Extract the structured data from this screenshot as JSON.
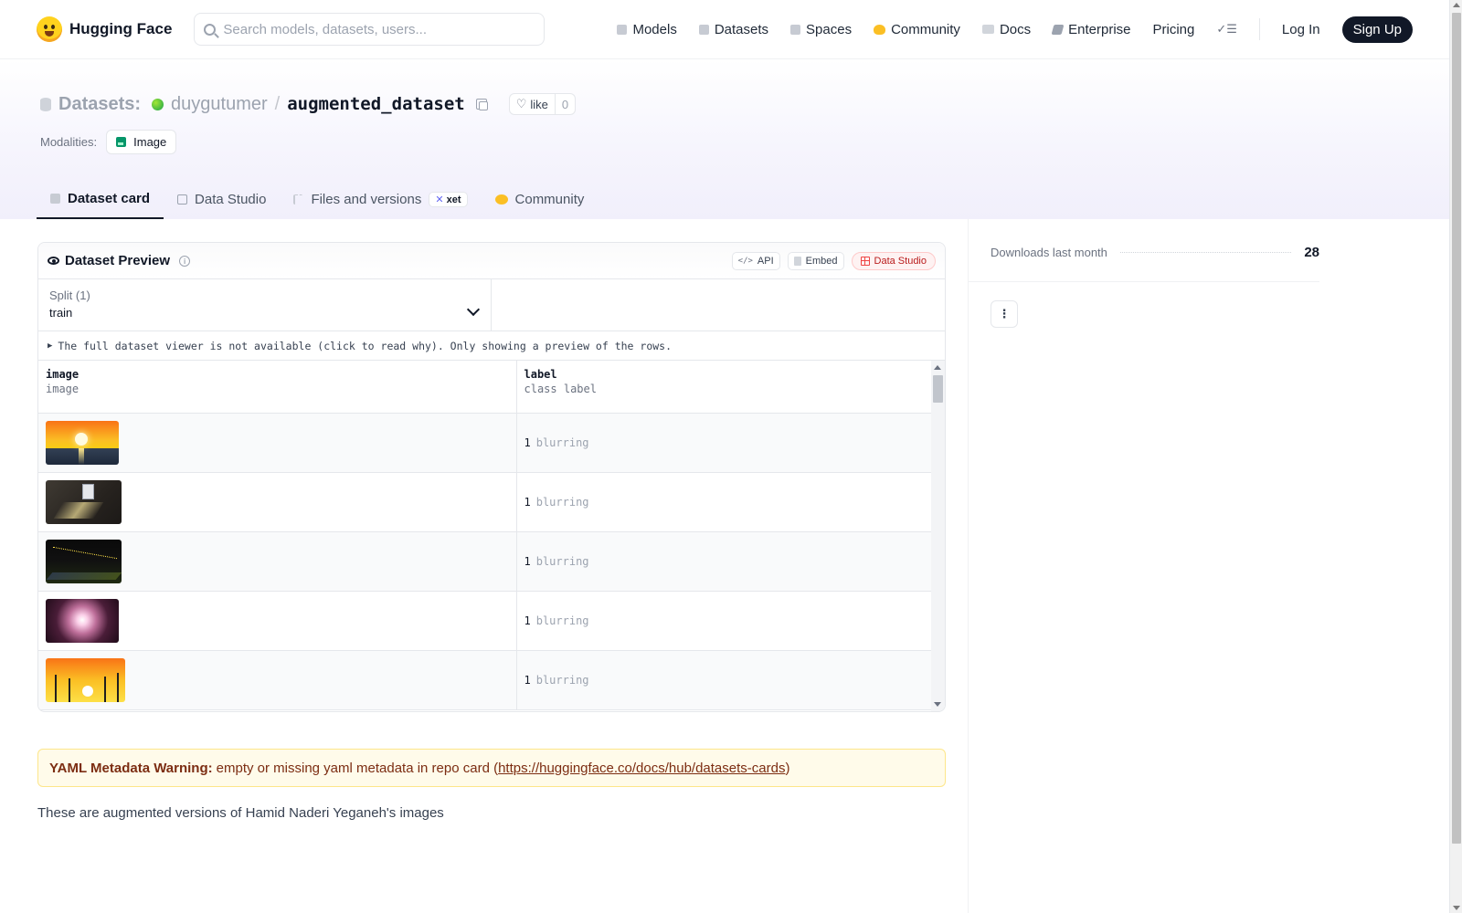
{
  "nav": {
    "brand": "Hugging Face",
    "search_placeholder": "Search models, datasets, users...",
    "links": [
      "Models",
      "Datasets",
      "Spaces",
      "Community",
      "Docs",
      "Enterprise",
      "Pricing"
    ],
    "login": "Log In",
    "signup": "Sign Up"
  },
  "header": {
    "section": "Datasets:",
    "owner": "duygutumer",
    "separator": "/",
    "name": "augmented_dataset",
    "like_label": "like",
    "like_count": "0",
    "modalities_label": "Modalities:",
    "modality": "Image"
  },
  "tabs": [
    {
      "label": "Dataset card",
      "active": true
    },
    {
      "label": "Data Studio"
    },
    {
      "label": "Files and versions",
      "badge": "xet"
    },
    {
      "label": "Community"
    }
  ],
  "preview": {
    "title": "Dataset Preview",
    "info": "i",
    "buttons": {
      "api": "API",
      "embed": "Embed",
      "studio": "Data Studio"
    },
    "split_label": "Split (1)",
    "split_value": "train",
    "notice": "The full dataset viewer is not available (click to read why). Only showing a preview of the rows.",
    "columns": [
      {
        "name": "image",
        "type": "image"
      },
      {
        "name": "label",
        "type": "class label"
      }
    ],
    "rows": [
      {
        "thumb": "sunset-horizon",
        "label_id": "1",
        "label_name": "blurring"
      },
      {
        "thumb": "dark-room-window",
        "label_id": "1",
        "label_name": "blurring"
      },
      {
        "thumb": "night-road-lights",
        "label_id": "1",
        "label_name": "blurring"
      },
      {
        "thumb": "pink-starburst",
        "label_id": "1",
        "label_name": "blurring"
      },
      {
        "thumb": "wind-turbines-sunset",
        "label_id": "1",
        "label_name": "blurring"
      }
    ]
  },
  "warning": {
    "title": "YAML Metadata Warning:",
    "text": "empty or missing yaml metadata in repo card (",
    "link": "https://huggingface.co/docs/hub/datasets-cards",
    "close": ")"
  },
  "description": "These are augmented versions of Hamid Naderi Yeganeh's images",
  "sidebar": {
    "downloads_label": "Downloads last month",
    "downloads_count": "28",
    "more": "⋮"
  }
}
